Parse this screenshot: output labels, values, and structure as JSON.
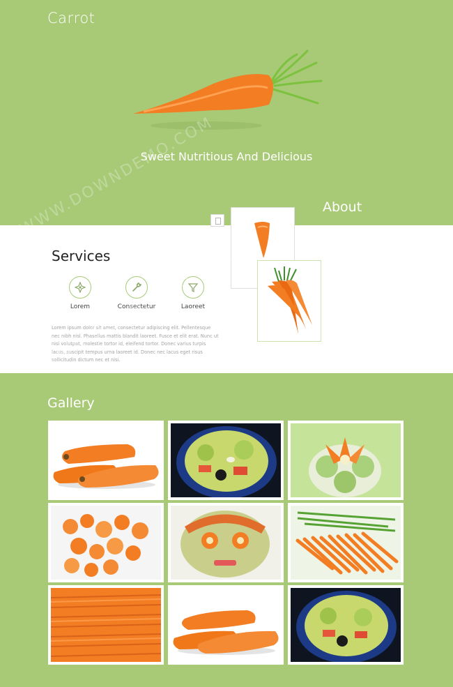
{
  "header": {
    "brand": "Carrot"
  },
  "hero": {
    "tagline": "Sweet Nutritious And Delicious"
  },
  "about": {
    "label": "About"
  },
  "services": {
    "title": "Services",
    "items": [
      {
        "label": "Lorem",
        "icon": "compass-icon"
      },
      {
        "label": "Consectetur",
        "icon": "wrench-icon"
      },
      {
        "label": "Laoreet",
        "icon": "funnel-icon"
      }
    ],
    "body": "Lorem ipsum dolor sit amet, consectetur adipiscing elit. Pellentesque nec nibh nisl. Phasellus mattis blandit laoreet. Fusce et elit erat. Nunc ut nisi volutpat, molestie tortor id, eleifend tortor. Donec varius turpis lacus, suscipit tempus urna laoreet id. Donec nec lacus eget risus sollicitudin dictum nec et nisi."
  },
  "gallery": {
    "title": "Gallery"
  },
  "colors": {
    "accent": "#a8ca76",
    "carrot": "#f27d23"
  }
}
